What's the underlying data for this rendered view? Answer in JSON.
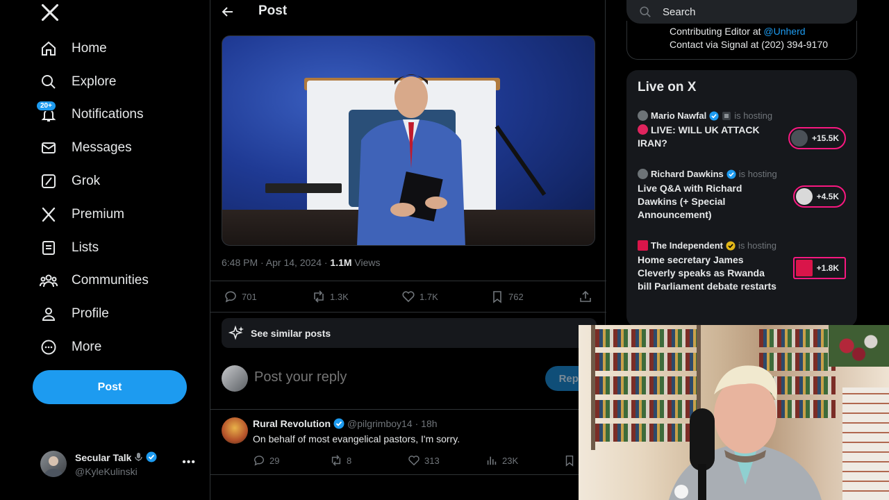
{
  "nav": {
    "items": [
      {
        "label": "Home",
        "icon": "home-icon"
      },
      {
        "label": "Explore",
        "icon": "search-icon"
      },
      {
        "label": "Notifications",
        "icon": "bell-icon",
        "badge": "20+"
      },
      {
        "label": "Messages",
        "icon": "mail-icon"
      },
      {
        "label": "Grok",
        "icon": "grok-icon"
      },
      {
        "label": "Premium",
        "icon": "x-icon"
      },
      {
        "label": "Lists",
        "icon": "list-icon"
      },
      {
        "label": "Communities",
        "icon": "communities-icon"
      },
      {
        "label": "Profile",
        "icon": "person-icon"
      },
      {
        "label": "More",
        "icon": "more-circle-icon"
      }
    ],
    "post_label": "Post"
  },
  "account": {
    "name": "Secular Talk",
    "handle": "@KyleKulinski"
  },
  "header": {
    "title": "Post"
  },
  "post": {
    "time": "6:48 PM · Apr 14, 2024 · ",
    "views_count": "1.1M",
    "views_label": " Views",
    "replies": "701",
    "reposts": "1.3K",
    "likes": "1.7K",
    "bookmarks": "762"
  },
  "similar": {
    "label": "See similar posts"
  },
  "reply": {
    "placeholder": "Post your reply",
    "button": "Reply"
  },
  "comment": {
    "name": "Rural Revolution",
    "handle": "@pilgrimboy14",
    "time": "· 18h",
    "text": "On behalf of most evangelical pastors, I'm sorry.",
    "replies": "29",
    "reposts": "8",
    "likes": "313",
    "views": "23K"
  },
  "search": {
    "placeholder": "Search"
  },
  "bio": {
    "line1_prefix": "Contributing Editor at ",
    "line1_link": "@Unherd",
    "line2": "Contact via Signal at (202) 394-9170"
  },
  "live": {
    "title": "Live on X",
    "hosting_label": "is hosting",
    "items": [
      {
        "host": "Mario Nawfal",
        "text": "LIVE: WILL UK ATTACK IRAN?",
        "count": "+15.5K"
      },
      {
        "host": "Richard Dawkins",
        "text": "Live Q&A with Richard Dawkins (+ Special Announcement)",
        "count": "+4.5K"
      },
      {
        "host": "The Independent",
        "text": "Home secretary James Cleverly speaks as Rwanda bill Parliament debate restarts",
        "count": "+1.8K"
      }
    ]
  },
  "colors": {
    "accent": "#1d9bf0",
    "live": "#f91880",
    "background": "#000000",
    "border": "#2f3336"
  }
}
